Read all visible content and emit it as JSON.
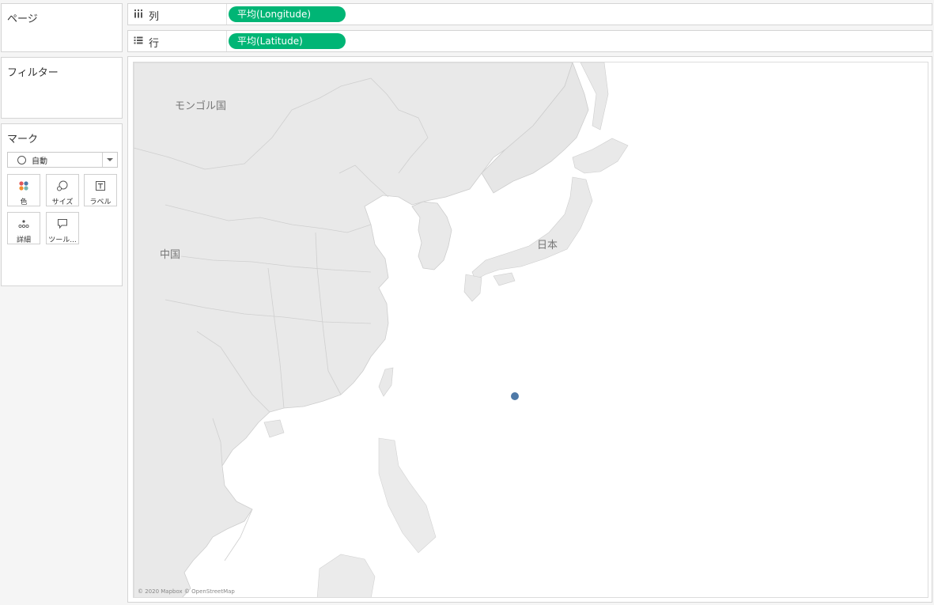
{
  "pages_card": {
    "title": "ページ"
  },
  "filters_card": {
    "title": "フィルター"
  },
  "marks_card": {
    "title": "マーク",
    "mark_type": "自動",
    "buttons": [
      {
        "label": "色",
        "icon": "color-icon"
      },
      {
        "label": "サイズ",
        "icon": "size-icon"
      },
      {
        "label": "ラベル",
        "icon": "label-icon"
      },
      {
        "label": "詳細",
        "icon": "detail-icon"
      },
      {
        "label": "ツール...",
        "icon": "tooltip-icon"
      }
    ]
  },
  "columns_shelf": {
    "label": "列",
    "icon": "columns-icon",
    "pill": "平均(Longitude)"
  },
  "rows_shelf": {
    "label": "行",
    "icon": "rows-icon",
    "pill": "平均(Latitude)"
  },
  "map": {
    "labels": {
      "mongolia": "モンゴル国",
      "china": "中国",
      "japan": "日本"
    },
    "attribution": "© 2020 Mapbox © OpenStreetMap",
    "point_color": "#4e79a7",
    "pill_color": "#00b575"
  }
}
